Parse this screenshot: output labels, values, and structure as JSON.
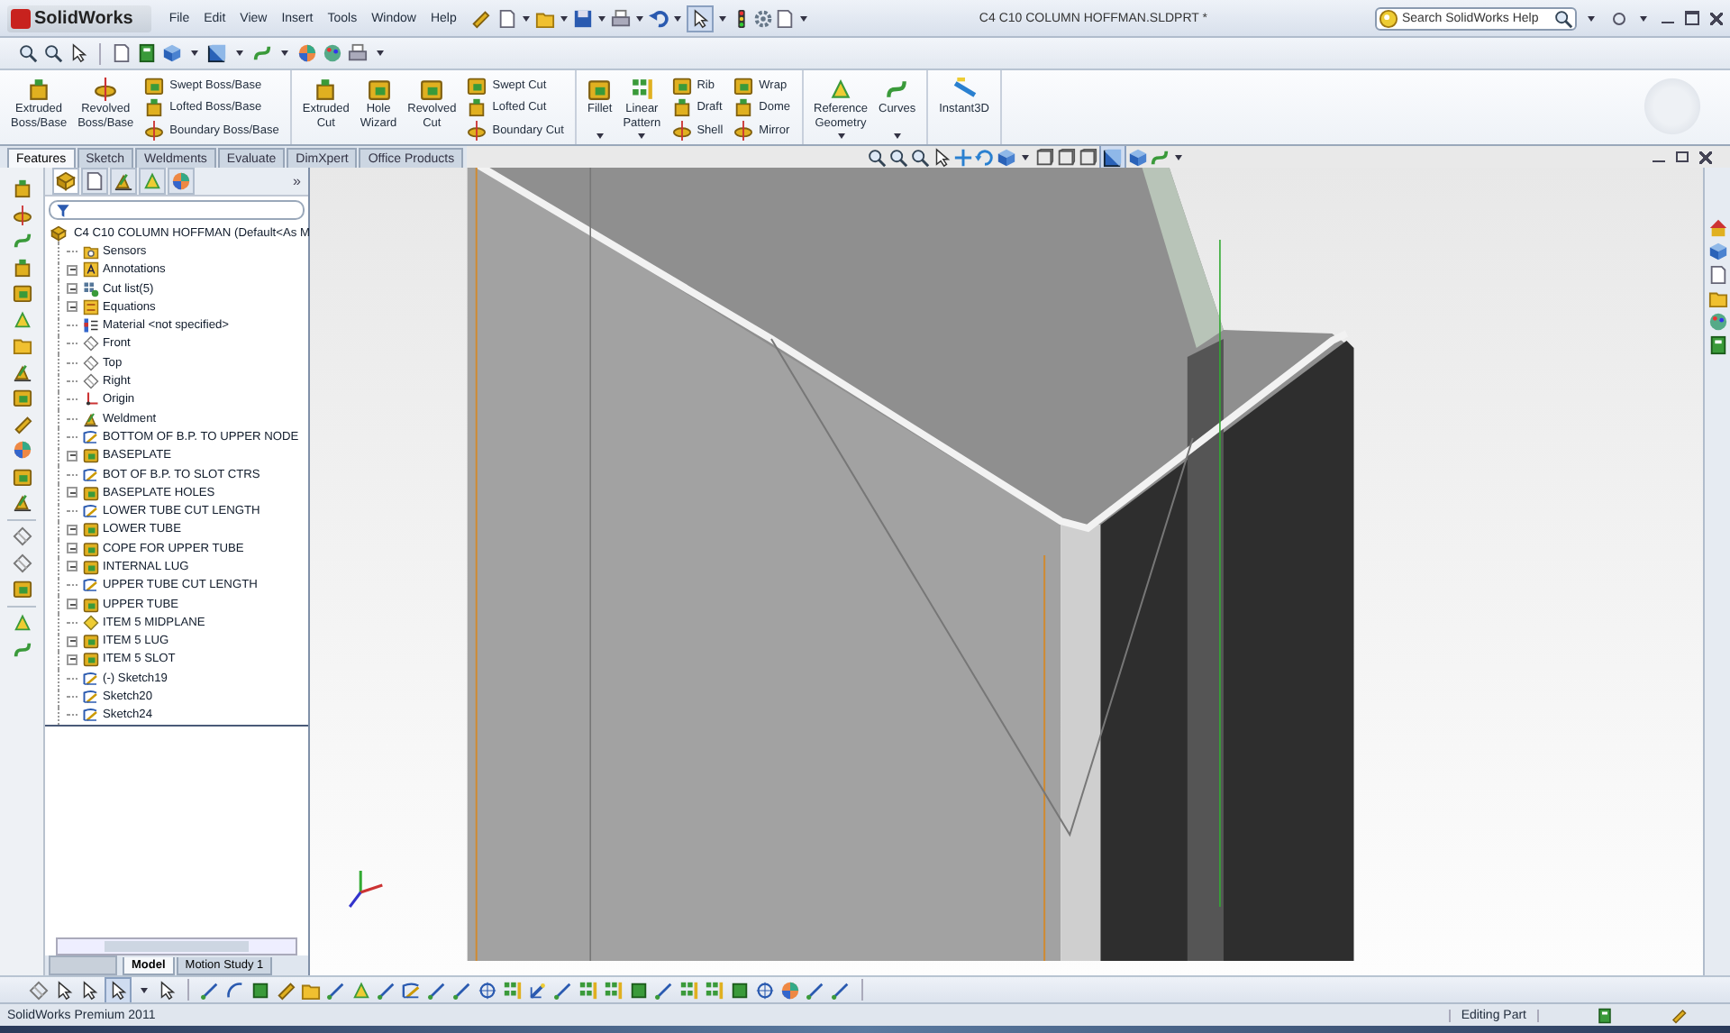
{
  "app": {
    "logo": "SolidWorks",
    "menu": [
      "File",
      "Edit",
      "View",
      "Insert",
      "Tools",
      "Window",
      "Help"
    ],
    "document_title": "C4 C10 COLUMN HOFFMAN.SLDPRT *",
    "search": {
      "placeholder": "Search SolidWorks Help"
    }
  },
  "command_manager": [
    {
      "items": [
        {
          "kind": "big",
          "label": "Extruded\nBoss/Base",
          "dropdown": false
        },
        {
          "kind": "big",
          "label": "Revolved\nBoss/Base",
          "dropdown": false
        },
        {
          "kind": "stack",
          "labels": [
            "Swept Boss/Base",
            "Lofted Boss/Base",
            "Boundary Boss/Base"
          ]
        }
      ]
    },
    {
      "items": [
        {
          "kind": "big",
          "label": "Extruded\nCut",
          "dropdown": false
        },
        {
          "kind": "big",
          "label": "Hole\nWizard",
          "dropdown": false
        },
        {
          "kind": "big",
          "label": "Revolved\nCut",
          "dropdown": false
        },
        {
          "kind": "stack",
          "labels": [
            "Swept Cut",
            "Lofted Cut",
            "Boundary Cut"
          ]
        }
      ]
    },
    {
      "items": [
        {
          "kind": "big",
          "label": "Fillet",
          "dropdown": true
        },
        {
          "kind": "big",
          "label": "Linear\nPattern",
          "dropdown": true
        },
        {
          "kind": "stack",
          "labels": [
            "Rib",
            "Draft",
            "Shell"
          ]
        },
        {
          "kind": "stack",
          "labels": [
            "Wrap",
            "Dome",
            "Mirror"
          ]
        }
      ]
    },
    {
      "items": [
        {
          "kind": "big",
          "label": "Reference\nGeometry",
          "dropdown": true
        },
        {
          "kind": "big",
          "label": "Curves",
          "dropdown": true
        }
      ]
    },
    {
      "items": [
        {
          "kind": "big",
          "label": "Instant3D",
          "dropdown": false
        }
      ]
    }
  ],
  "tabs": [
    {
      "label": "Features",
      "selected": true
    },
    {
      "label": "Sketch",
      "selected": false
    },
    {
      "label": "Weldments",
      "selected": false
    },
    {
      "label": "Evaluate",
      "selected": false
    },
    {
      "label": "DimXpert",
      "selected": false
    },
    {
      "label": "Office Products",
      "selected": false
    }
  ],
  "tree": {
    "panel_tabs": [
      {
        "selected": true
      },
      {
        "selected": false
      },
      {
        "selected": false
      },
      {
        "selected": false
      },
      {
        "selected": false
      }
    ],
    "expand_label": "»",
    "root": "C4 C10 COLUMN HOFFMAN  (Default<As M",
    "items": [
      {
        "label": "Sensors",
        "kind": "sensor",
        "expander": false
      },
      {
        "label": "Annotations",
        "kind": "annotation",
        "expander": true
      },
      {
        "label": "Cut list(5)",
        "kind": "cutlist",
        "expander": true
      },
      {
        "label": "Equations",
        "kind": "equation",
        "expander": true
      },
      {
        "label": "Material <not specified>",
        "kind": "material",
        "expander": false
      },
      {
        "label": "Front",
        "kind": "plane",
        "expander": false
      },
      {
        "label": "Top",
        "kind": "plane",
        "expander": false
      },
      {
        "label": "Right",
        "kind": "plane",
        "expander": false
      },
      {
        "label": "Origin",
        "kind": "origin",
        "expander": false
      },
      {
        "label": "Weldment",
        "kind": "weldment",
        "expander": false
      },
      {
        "label": "BOTTOM OF B.P. TO UPPER NODE",
        "kind": "sketch",
        "expander": false
      },
      {
        "label": "BASEPLATE",
        "kind": "feature",
        "expander": true
      },
      {
        "label": "BOT OF B.P. TO SLOT CTRS",
        "kind": "sketch",
        "expander": false
      },
      {
        "label": "BASEPLATE HOLES",
        "kind": "feature",
        "expander": true
      },
      {
        "label": "LOWER TUBE CUT LENGTH",
        "kind": "sketch",
        "expander": false
      },
      {
        "label": "LOWER TUBE",
        "kind": "feature",
        "expander": true
      },
      {
        "label": "COPE FOR UPPER TUBE",
        "kind": "feature",
        "expander": true
      },
      {
        "label": "INTERNAL LUG",
        "kind": "feature",
        "expander": true
      },
      {
        "label": "UPPER TUBE CUT LENGTH",
        "kind": "sketch",
        "expander": false
      },
      {
        "label": "UPPER TUBE",
        "kind": "feature",
        "expander": true
      },
      {
        "label": "ITEM 5 MIDPLANE",
        "kind": "refplane",
        "expander": false
      },
      {
        "label": "ITEM 5 LUG",
        "kind": "feature",
        "expander": true
      },
      {
        "label": "ITEM 5 SLOT",
        "kind": "feature",
        "expander": true
      },
      {
        "label": "(-) Sketch19",
        "kind": "sketch",
        "expander": false
      },
      {
        "label": "Sketch20",
        "kind": "sketch",
        "expander": false
      },
      {
        "label": "Sketch24",
        "kind": "sketch",
        "expander": false
      }
    ]
  },
  "bottom_tabs": [
    {
      "label": "Model",
      "selected": true
    },
    {
      "label": "Motion Study 1",
      "selected": false
    }
  ],
  "status_bar": {
    "product": "SolidWorks Premium 2011",
    "mode": "Editing Part"
  }
}
